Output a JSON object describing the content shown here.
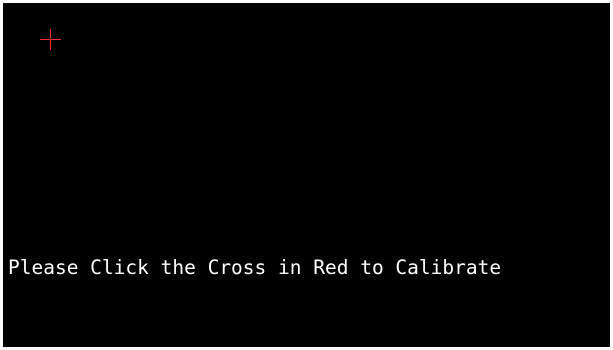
{
  "calibration": {
    "instruction": "Please Click the Cross in Red to Calibrate",
    "target_icon": "crosshair-icon",
    "colors": {
      "background": "#000000",
      "cross": "#ff2a2a",
      "text": "#ffffff"
    }
  }
}
